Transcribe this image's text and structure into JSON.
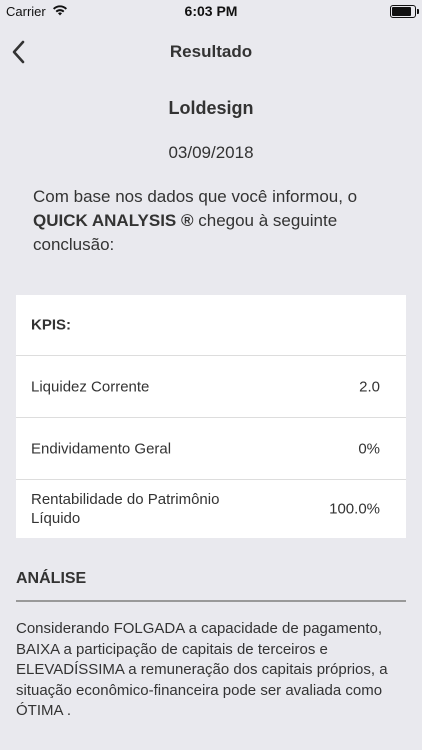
{
  "status_bar": {
    "carrier": "Carrier",
    "time": "6:03 PM",
    "battery_level": 0.95
  },
  "nav": {
    "title": "Resultado"
  },
  "company": "Loldesign",
  "date": "03/09/2018",
  "intro": {
    "before": "Com base nos dados que você informou, o ",
    "brand": "QUICK ANALYSIS ®",
    "after": " chegou à seguinte conclusão:"
  },
  "kpis": {
    "title": "KPIS:",
    "rows": [
      {
        "label": "Liquidez Corrente",
        "value": "2.0"
      },
      {
        "label": "Endividamento Geral",
        "value": "0%"
      },
      {
        "label": "Rentabilidade do Patrimônio Líquido",
        "value": "100.0%"
      }
    ]
  },
  "analysis": {
    "title": "ANÁLISE",
    "text": "Considerando FOLGADA a capacidade de pagamento, BAIXA a participação de capitais de terceiros e ELEVADÍSSIMA a remuneração dos capitais próprios, a situação econômico-financeira pode ser avaliada como ÓTIMA ."
  }
}
